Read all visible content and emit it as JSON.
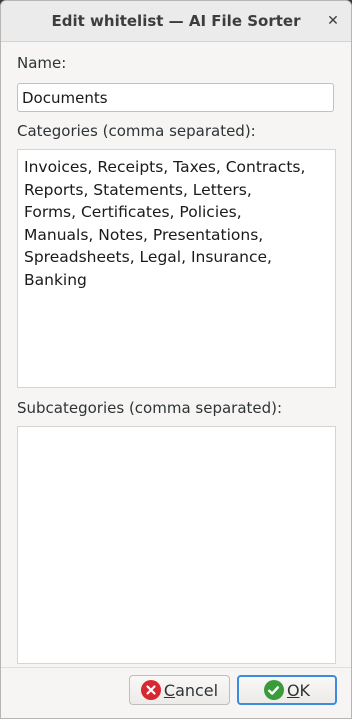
{
  "window": {
    "title": "Edit whitelist — AI File Sorter",
    "close_glyph": "✕"
  },
  "form": {
    "name_label": "Name:",
    "name_value": "Documents",
    "categories_label": "Categories (comma separated):",
    "categories_value": "Invoices, Receipts, Taxes, Contracts,\nReports, Statements, Letters,\nForms, Certificates, Policies,\nManuals, Notes, Presentations,\nSpreadsheets, Legal, Insurance,\nBanking",
    "subcategories_label": "Subcategories (comma separated):",
    "subcategories_value": ""
  },
  "buttons": {
    "cancel_mnemonic": "C",
    "cancel_rest": "ancel",
    "ok_mnemonic": "O",
    "ok_rest": "K"
  },
  "icons": {
    "cancel": "cancel-circle-icon",
    "ok": "check-circle-icon"
  },
  "colors": {
    "cancel_icon": "#d7282f",
    "ok_icon": "#3a9b3a",
    "default_button_border": "#3b8be0"
  }
}
